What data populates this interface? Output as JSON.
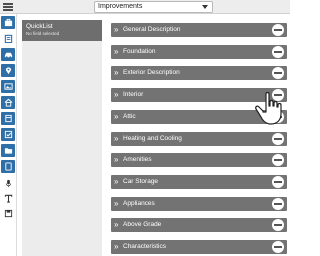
{
  "topbar": {
    "dropdown_value": "Improvements"
  },
  "rail": {
    "items": [
      {
        "icon": "briefcase-icon"
      },
      {
        "icon": "clipboard-icon"
      },
      {
        "icon": "car-icon"
      },
      {
        "icon": "map-pin-icon"
      },
      {
        "icon": "image-icon"
      },
      {
        "icon": "house-icon"
      },
      {
        "icon": "bookmark-icon"
      },
      {
        "icon": "checkbox-icon"
      },
      {
        "icon": "folder-icon"
      },
      {
        "icon": "document-icon"
      },
      {
        "icon": "microphone-icon"
      },
      {
        "icon": "text-tool-icon"
      },
      {
        "icon": "save-icon"
      }
    ],
    "accent_color": "#2f6fa8"
  },
  "quicklist": {
    "title": "QuickList",
    "subtitle": "No field selected"
  },
  "sections": [
    {
      "label": "General Description"
    },
    {
      "label": "Foundation"
    },
    {
      "label": "Exterior Description"
    },
    {
      "label": "Interior"
    },
    {
      "label": "Attic"
    },
    {
      "label": "Heating and Cooling"
    },
    {
      "label": "Amenities"
    },
    {
      "label": "Car Storage"
    },
    {
      "label": "Appliances"
    },
    {
      "label": "Above Grade"
    },
    {
      "label": "Characteristics"
    }
  ],
  "section_chevron": "»",
  "colors": {
    "section_bar": "#737373",
    "quicklist_header": "#6e6e6e",
    "quicklist_bg": "#ececec"
  }
}
